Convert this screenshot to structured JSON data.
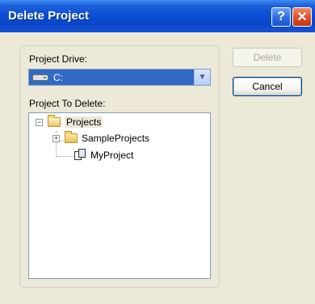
{
  "window": {
    "title": "Delete Project"
  },
  "titlebar": {
    "help_label": "?",
    "close_label": "✕"
  },
  "form": {
    "drive_label": "Project Drive:",
    "drive_value": "C:",
    "delete_label": "Project To Delete:"
  },
  "tree": {
    "root": {
      "label": "Projects",
      "expander": "−"
    },
    "children": [
      {
        "label": "SampleProjects",
        "expander": "+"
      },
      {
        "label": "MyProject"
      }
    ]
  },
  "buttons": {
    "delete_label": "Delete",
    "cancel_label": "Cancel"
  },
  "colors": {
    "title_bar": "#0b46c8",
    "selection": "#316ac5",
    "background": "#ece9d8"
  }
}
